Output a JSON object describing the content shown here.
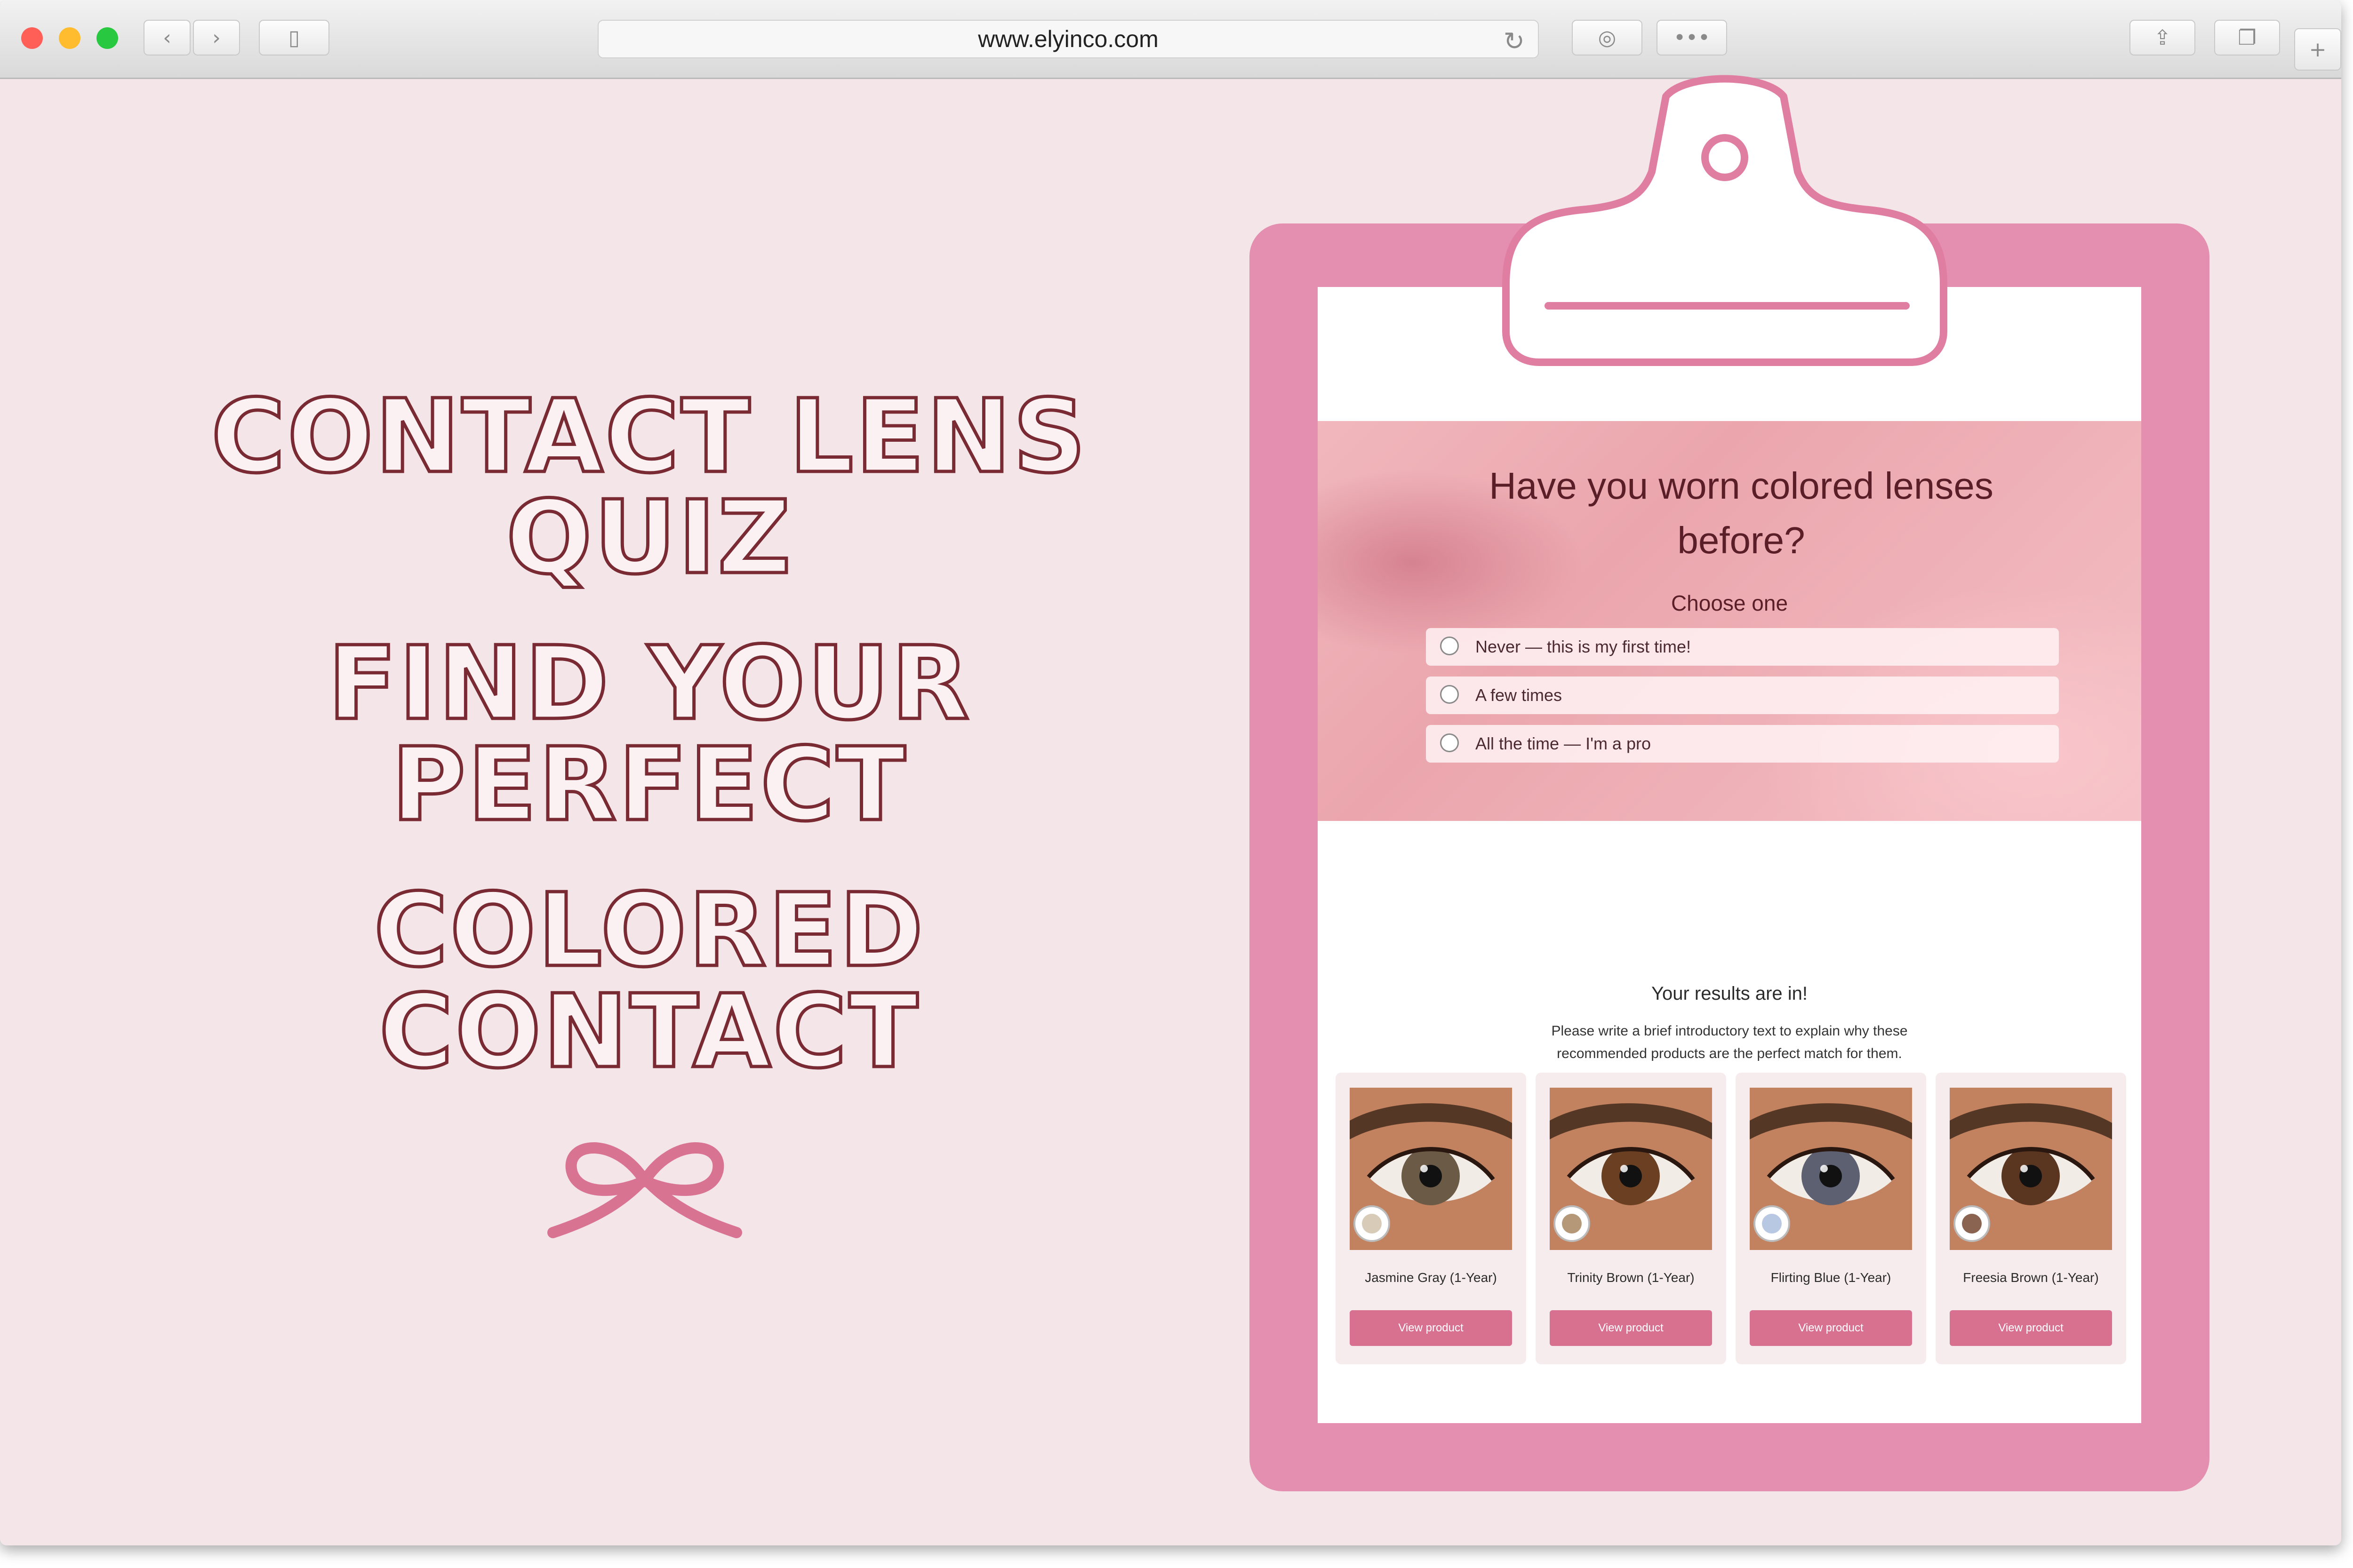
{
  "browser": {
    "url": "www.elyinco.com"
  },
  "headline": {
    "line1": "CONTACT LENS QUIZ",
    "line2": "FIND YOUR PERFECT",
    "line3": "COLORED CONTACT"
  },
  "quiz": {
    "question": "Have you worn colored lenses before?",
    "subtitle": "Choose one",
    "options": [
      "Never — this is my first time!",
      "A few times",
      "All the time — I'm a pro"
    ]
  },
  "results": {
    "title": "Your results are in!",
    "intro": "Please write a brief introductory text to explain why these recommended products are the perfect match for them.",
    "products": [
      {
        "name": "Jasmine Gray (1-Year)",
        "button": "View product",
        "iris_color": "#6b5a45",
        "swatch_color": "#d8cbb8"
      },
      {
        "name": "Trinity Brown (1-Year)",
        "button": "View product",
        "iris_color": "#6a3f22",
        "swatch_color": "#b59878"
      },
      {
        "name": "Flirting Blue (1-Year)",
        "button": "View product",
        "iris_color": "#5d6070",
        "swatch_color": "#b9c8e2"
      },
      {
        "name": "Freesia Brown (1-Year)",
        "button": "View product",
        "iris_color": "#5a3520",
        "swatch_color": "#8a6450"
      }
    ]
  },
  "colors": {
    "page_bg": "#f4e6e8",
    "clipboard": "#e58fb0",
    "button": "#d8718f",
    "headline_stroke": "#7a2a33"
  }
}
